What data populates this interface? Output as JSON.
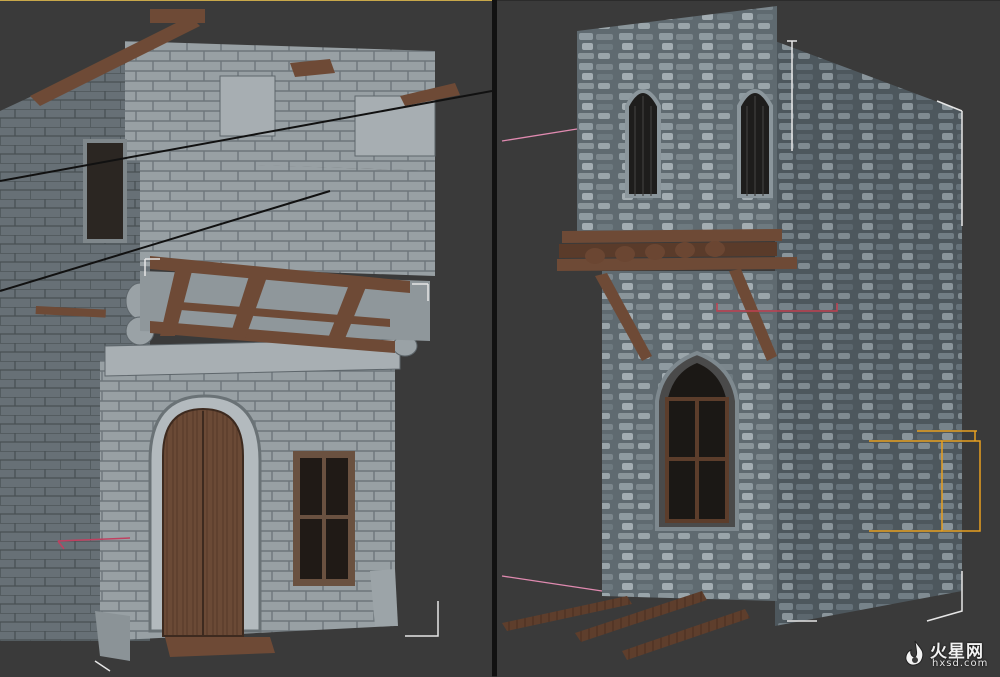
{
  "viewports": [
    {
      "name": "left-viewport",
      "subject": "stone-house-model"
    },
    {
      "name": "right-viewport",
      "subject": "stone-tower-model"
    }
  ],
  "colors": {
    "viewport_bg": "#3a3a3a",
    "active_border": "#c8a84a",
    "stone_light": "#9aa2a6",
    "stone_dark": "#5e676d",
    "wood": "#6e4a36",
    "selection_orange": "#e8a020",
    "pink_helper": "#e08ab0",
    "bbox_white": "#e6e6e6"
  },
  "icons": [
    "fire-star-logo-icon"
  ],
  "watermark": {
    "text_cn": "火星网",
    "text_en": "hxsd.com"
  }
}
